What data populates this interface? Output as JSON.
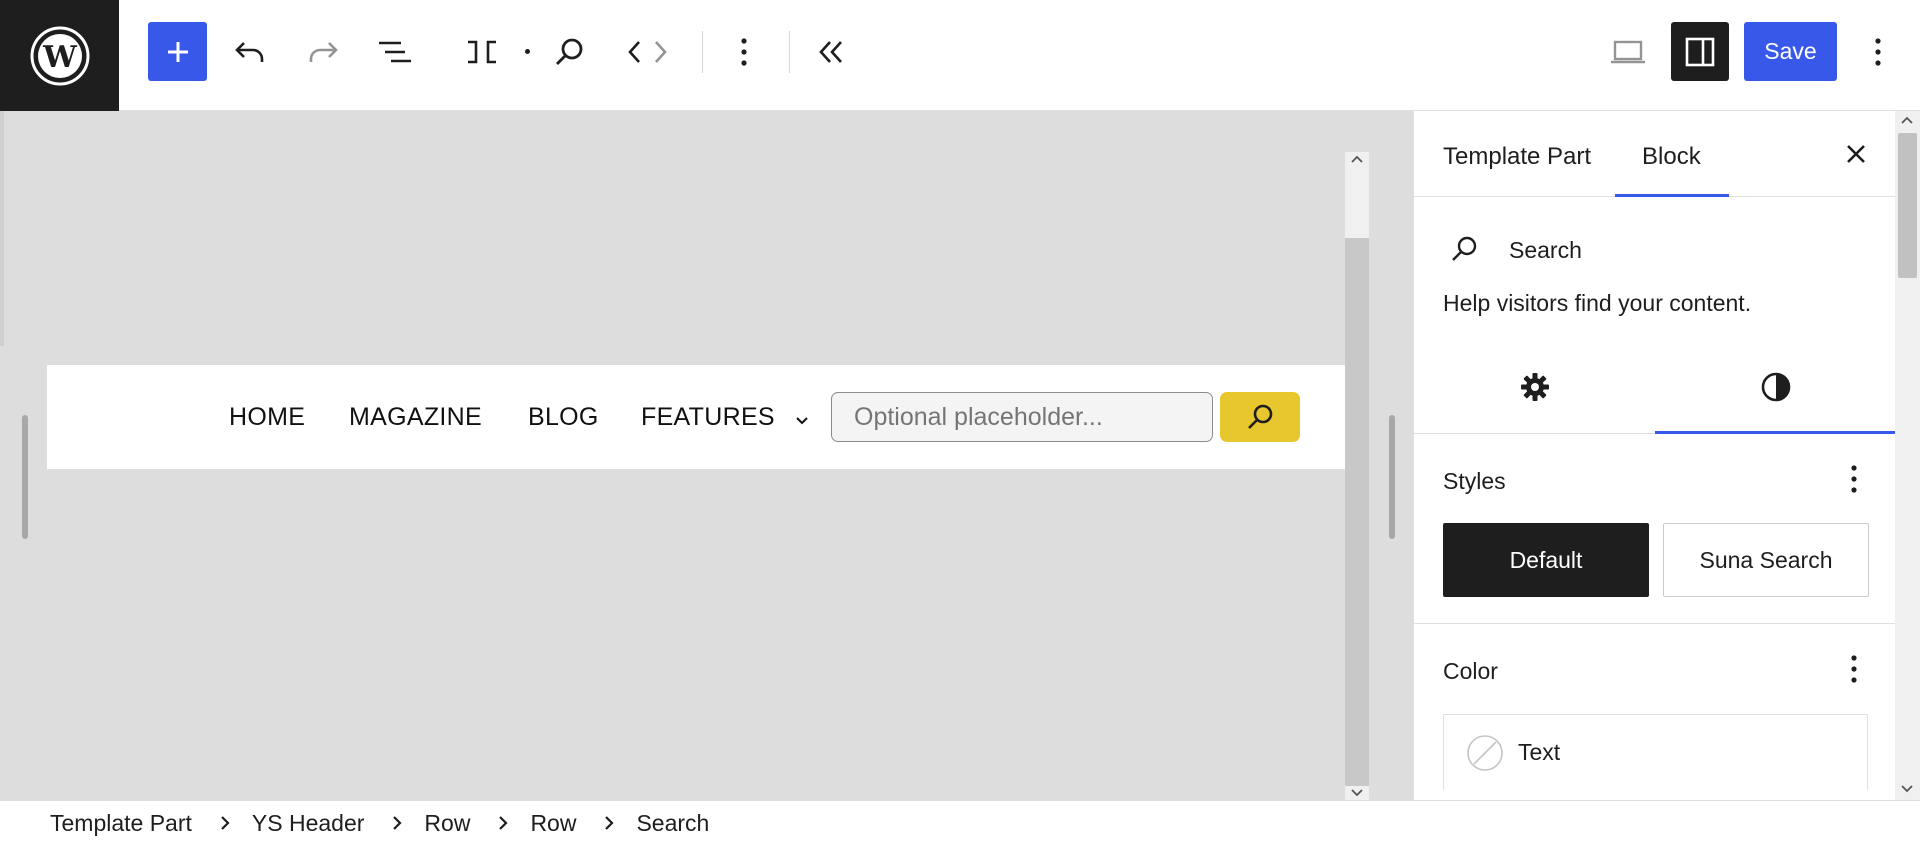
{
  "toolbar": {
    "save_label": "Save",
    "icons": [
      "wordpress-logo",
      "plus-icon",
      "undo-icon",
      "redo-icon",
      "list-view-icon",
      "template-part-icon",
      "search-icon",
      "chevron-left-icon",
      "chevron-right-icon",
      "more-vertical-icon",
      "chevron-double-left-icon",
      "desktop-preview-icon",
      "sidebar-toggle-icon"
    ]
  },
  "canvas": {
    "nav": [
      "HOME",
      "MAGAZINE",
      "BLOG",
      "FEATURES"
    ],
    "search_placeholder": "Optional placeholder...",
    "accent": "#e8c62d"
  },
  "breadcrumb": [
    "Template Part",
    "YS Header",
    "Row",
    "Row",
    "Search"
  ],
  "sidebar": {
    "tabs": [
      "Template Part",
      "Block"
    ],
    "active_tab": "Block",
    "block": {
      "title": "Search",
      "description": "Help visitors find your content."
    },
    "styles": {
      "title": "Styles",
      "options": [
        "Default",
        "Suna Search"
      ],
      "selected": "Default"
    },
    "color": {
      "title": "Color",
      "items": [
        "Text"
      ]
    }
  },
  "colors": {
    "brand": "#3858e9",
    "dark": "#1e1e1e",
    "canvas_bg": "#dddddd"
  }
}
